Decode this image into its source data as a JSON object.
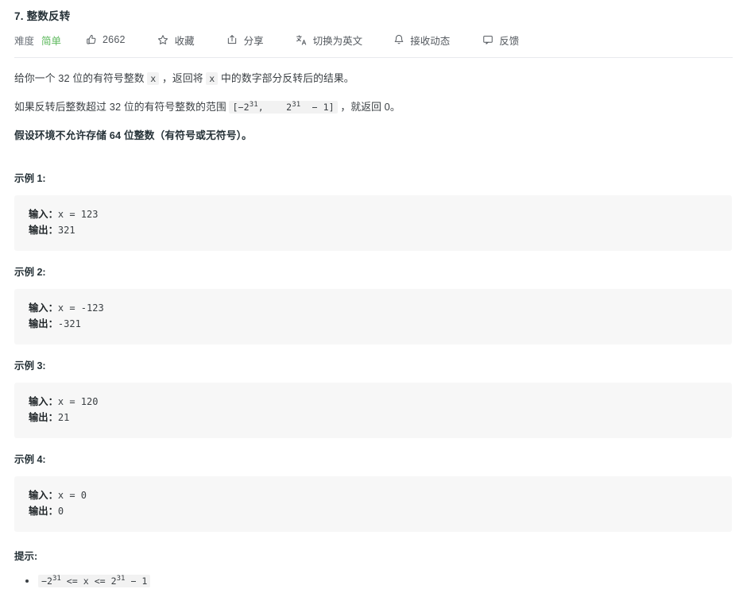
{
  "problem": {
    "title": "7. 整数反转",
    "difficulty_label": "难度",
    "difficulty_value": "简单",
    "difficulty_color": "#5cb85c"
  },
  "toolbar": {
    "like_icon": "thumbs-up-icon",
    "like_count": "2662",
    "favorite_icon": "star-icon",
    "favorite_label": "收藏",
    "share_icon": "share-icon",
    "share_label": "分享",
    "translate_icon": "translate-icon",
    "translate_label": "切换为英文",
    "subscribe_icon": "bell-icon",
    "subscribe_label": "接收动态",
    "feedback_icon": "comment-icon",
    "feedback_label": "反馈"
  },
  "description": {
    "p1_part1": "给你一个 32 位的有符号整数 ",
    "p1_code1": "x",
    "p1_part2": " ，返回将 ",
    "p1_code2": "x",
    "p1_part3": " 中的数字部分反转后的结果。",
    "p2_part1": "如果反转后整数超过 32 位的有符号整数的范围 ",
    "p2_code_pre": "[−2",
    "p2_code_sup1": "31",
    "p2_code_mid": ",    2",
    "p2_code_sup2": "31",
    "p2_code_post": "  − 1]",
    "p2_part2": " ，就返回 0。",
    "p3": "假设环境不允许存储 64 位整数（有符号或无符号）。"
  },
  "examples": [
    {
      "heading": "示例 1:",
      "input_label": "输入：",
      "input_value": "x = 123",
      "output_label": "输出：",
      "output_value": "321"
    },
    {
      "heading": "示例 2:",
      "input_label": "输入：",
      "input_value": "x = -123",
      "output_label": "输出：",
      "output_value": "-321"
    },
    {
      "heading": "示例 3:",
      "input_label": "输入：",
      "input_value": "x = 120",
      "output_label": "输出：",
      "output_value": "21"
    },
    {
      "heading": "示例 4:",
      "input_label": "输入：",
      "input_value": "x = 0",
      "output_label": "输出：",
      "output_value": "0"
    }
  ],
  "hints": {
    "heading": "提示:",
    "items": [
      {
        "code_pre": "−2",
        "code_sup1": "31",
        "code_mid": " <= x <= 2",
        "code_sup2": "31",
        "code_post": " − 1"
      }
    ]
  }
}
